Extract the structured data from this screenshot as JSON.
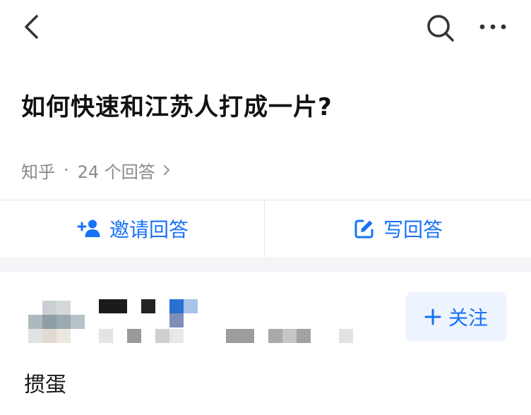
{
  "question": {
    "title": "如何快速和江苏人打成一片?"
  },
  "meta": {
    "source": "知乎",
    "separator": "·",
    "answer_count": "24 个回答"
  },
  "actions": {
    "invite_label": "邀请回答",
    "write_label": "写回答"
  },
  "answer": {
    "follow_label": "关注",
    "excerpt": "掼蛋"
  },
  "icons": {
    "back": "chevron-left-icon",
    "search": "search-icon",
    "more": "more-dots-icon",
    "meta_chevron": "chevron-right-icon",
    "invite": "add-person-icon",
    "write": "edit-icon",
    "follow": "plus-icon"
  },
  "colors": {
    "accent": "#1772f6",
    "follow_bg": "#eef4fe",
    "muted_text": "#8a8a8a",
    "divider": "#e6e6e6",
    "section_gap": "#f4f5f7"
  }
}
